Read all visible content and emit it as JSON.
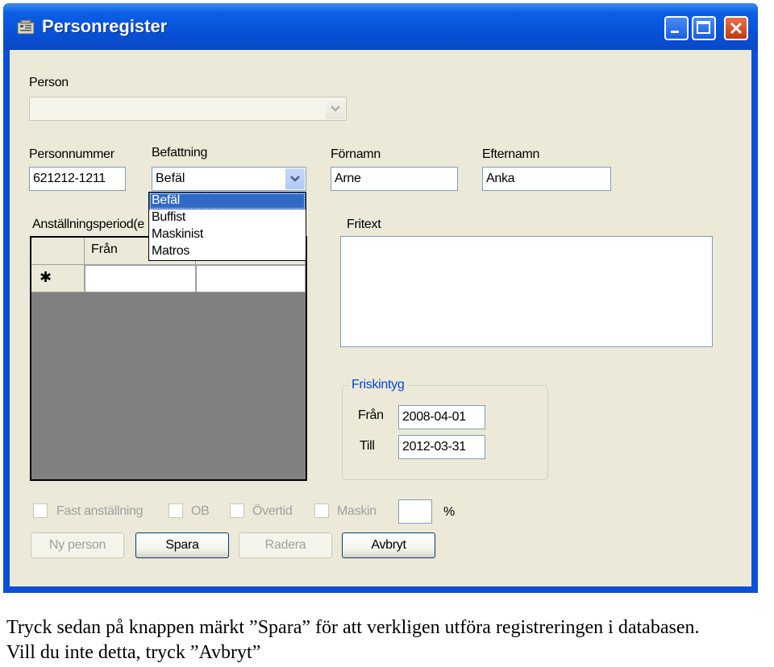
{
  "window": {
    "title": "Personregister"
  },
  "person": {
    "label": "Person",
    "value": ""
  },
  "personnummer": {
    "label": "Personnummer",
    "value": "621212-1211"
  },
  "befattning": {
    "label": "Befattning",
    "value": "Befäl",
    "options": [
      "Befäl",
      "Buffist",
      "Maskinist",
      "Matros"
    ],
    "selected_index": 0
  },
  "fornamn": {
    "label": "Förnamn",
    "value": "Arne"
  },
  "efternamn": {
    "label": "Efternamn",
    "value": "Anka"
  },
  "anstallning": {
    "label": "Anställningsperiod(e",
    "columns": [
      "Från"
    ],
    "new_row_marker": "✱"
  },
  "fritext": {
    "label": "Fritext",
    "value": ""
  },
  "friskintyg": {
    "legend": "Friskintyg",
    "fran_label": "Från",
    "fran_value": "2008-04-01",
    "till_label": "Till",
    "till_value": "2012-03-31"
  },
  "checkboxes": {
    "fast": "Fast anställning",
    "ob": "OB",
    "overtid": "Övertid",
    "maskin": "Maskin",
    "percent_value": "",
    "percent_unit": "%"
  },
  "buttons": {
    "ny_person": "Ny person",
    "spara": "Spara",
    "radera": "Radera",
    "avbryt": "Avbryt"
  },
  "caption": {
    "line1": "Tryck sedan på knappen märkt ”Spara” för att verkligen utföra registreringen i databasen.",
    "line2": "Vill du inte detta, tryck ”Avbryt”"
  },
  "colors": {
    "titlebar": "#0752d8",
    "client": "#ece9d8",
    "selection": "#316ac5",
    "groupbox_legend": "#0046d5"
  }
}
